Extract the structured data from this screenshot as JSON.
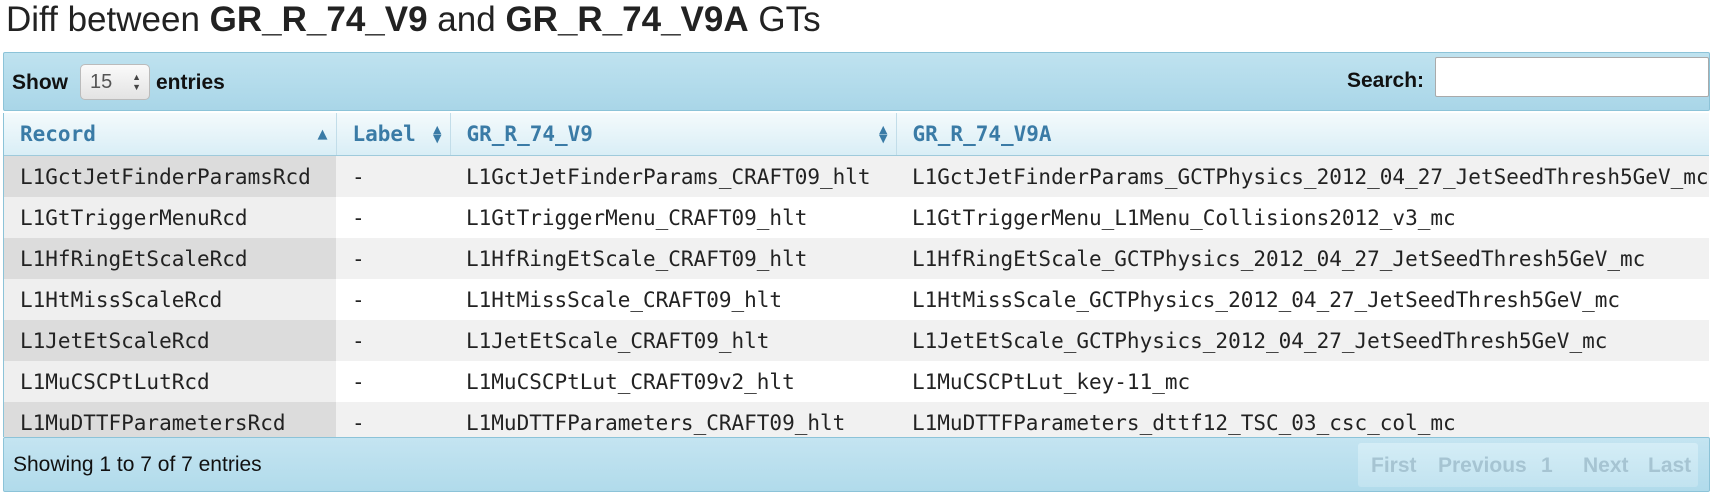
{
  "page_title": {
    "prefix": "Diff between ",
    "gt_a": "GR_R_74_V9",
    "middle": " and ",
    "gt_b": "GR_R_74_V9A",
    "suffix": " GTs"
  },
  "length_control": {
    "show_label": "Show",
    "value": "15",
    "entries_label": "entries"
  },
  "search": {
    "label": "Search:",
    "value": "",
    "placeholder": ""
  },
  "table": {
    "columns": [
      "Record",
      "Label",
      "GR_R_74_V9",
      "GR_R_74_V9A"
    ],
    "sorted_column": "Record",
    "sort_direction": "ascending",
    "rows": [
      [
        "L1GctJetFinderParamsRcd",
        "-",
        "L1GctJetFinderParams_CRAFT09_hlt",
        "L1GctJetFinderParams_GCTPhysics_2012_04_27_JetSeedThresh5GeV_mc"
      ],
      [
        "L1GtTriggerMenuRcd",
        "-",
        "L1GtTriggerMenu_CRAFT09_hlt",
        "L1GtTriggerMenu_L1Menu_Collisions2012_v3_mc"
      ],
      [
        "L1HfRingEtScaleRcd",
        "-",
        "L1HfRingEtScale_CRAFT09_hlt",
        "L1HfRingEtScale_GCTPhysics_2012_04_27_JetSeedThresh5GeV_mc"
      ],
      [
        "L1HtMissScaleRcd",
        "-",
        "L1HtMissScale_CRAFT09_hlt",
        "L1HtMissScale_GCTPhysics_2012_04_27_JetSeedThresh5GeV_mc"
      ],
      [
        "L1JetEtScaleRcd",
        "-",
        "L1JetEtScale_CRAFT09_hlt",
        "L1JetEtScale_GCTPhysics_2012_04_27_JetSeedThresh5GeV_mc"
      ],
      [
        "L1MuCSCPtLutRcd",
        "-",
        "L1MuCSCPtLut_CRAFT09v2_hlt",
        "L1MuCSCPtLut_key-11_mc"
      ],
      [
        "L1MuDTTFParametersRcd",
        "-",
        "L1MuDTTFParameters_CRAFT09_hlt",
        "L1MuDTTFParameters_dttf12_TSC_03_csc_col_mc"
      ]
    ]
  },
  "footer": {
    "info": "Showing 1 to 7 of 7 entries",
    "pagination": {
      "first": "First",
      "previous": "Previous",
      "current_page": "1",
      "next": "Next",
      "last": "Last"
    }
  },
  "colors": {
    "bar_background": "#b1dbeb",
    "header_text": "#3a7ba6",
    "disabled_pager": "#a6c4d2"
  }
}
